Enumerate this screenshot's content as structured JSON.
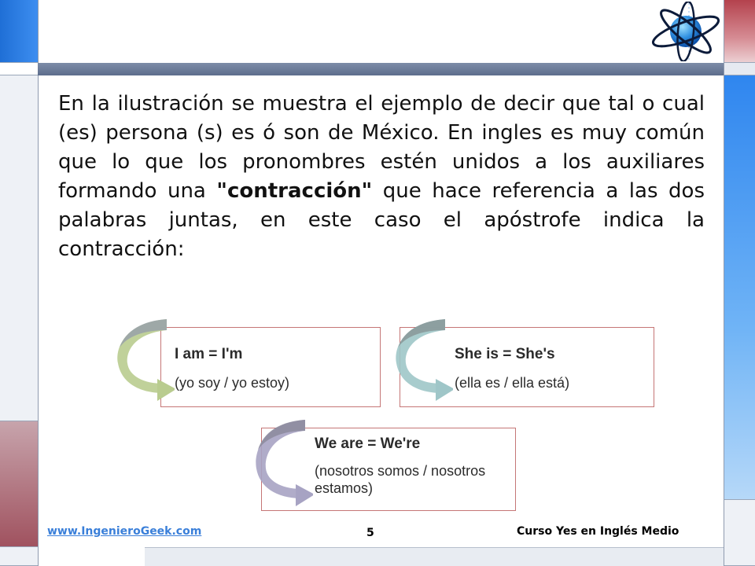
{
  "slide": {
    "paragraph": {
      "before": "En la ilustración se muestra el ejemplo de decir que tal o cual (es) persona (s) es ó son de México. En ingles es muy común que lo que los pronombres estén unidos a los auxiliares formando una ",
      "highlight": "\"contracción\"",
      "after": " que hace referencia a las dos palabras juntas, en este caso el apóstrofe indica la contracción:"
    },
    "cards": [
      {
        "title": "I am = I'm",
        "subtitle": "(yo soy / yo estoy)",
        "arc_color": "#b9cc8f"
      },
      {
        "title": "She is = She's",
        "subtitle": "(ella es / ella está)",
        "arc_color": "#9fc6c8"
      },
      {
        "title": "We are = We're",
        "subtitle": "(nosotros somos / nosotros estamos)",
        "arc_color": "#a7a3c3"
      }
    ]
  },
  "footer": {
    "link": "www.IngenieroGeek.com",
    "page_number": "5",
    "course": "Curso Yes en Inglés Medio"
  },
  "colors": {
    "accent_blue": "#2f86ef",
    "accent_red": "#b4424d",
    "card_border": "#c57676",
    "link": "#3a7fd9"
  },
  "icons": [
    "globe-logo-icon"
  ]
}
